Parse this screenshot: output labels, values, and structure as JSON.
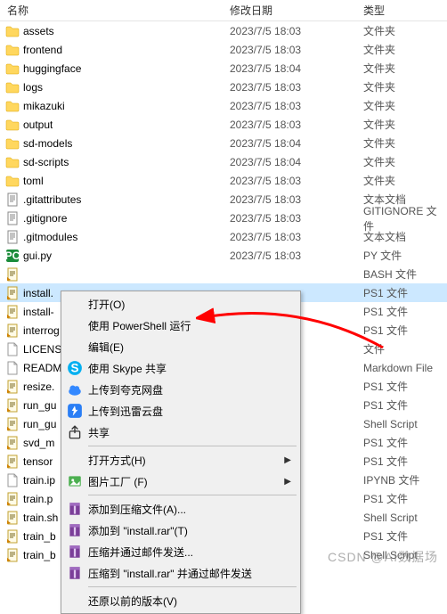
{
  "header": {
    "name": "名称",
    "date": "修改日期",
    "type": "类型"
  },
  "rows": [
    {
      "icon": "folder",
      "name": "assets",
      "date": "2023/7/5 18:03",
      "type": "文件夹"
    },
    {
      "icon": "folder",
      "name": "frontend",
      "date": "2023/7/5 18:03",
      "type": "文件夹"
    },
    {
      "icon": "folder",
      "name": "huggingface",
      "date": "2023/7/5 18:04",
      "type": "文件夹"
    },
    {
      "icon": "folder",
      "name": "logs",
      "date": "2023/7/5 18:03",
      "type": "文件夹"
    },
    {
      "icon": "folder",
      "name": "mikazuki",
      "date": "2023/7/5 18:03",
      "type": "文件夹"
    },
    {
      "icon": "folder",
      "name": "output",
      "date": "2023/7/5 18:03",
      "type": "文件夹"
    },
    {
      "icon": "folder",
      "name": "sd-models",
      "date": "2023/7/5 18:04",
      "type": "文件夹"
    },
    {
      "icon": "folder",
      "name": "sd-scripts",
      "date": "2023/7/5 18:04",
      "type": "文件夹"
    },
    {
      "icon": "folder",
      "name": "toml",
      "date": "2023/7/5 18:03",
      "type": "文件夹"
    },
    {
      "icon": "txt",
      "name": ".gitattributes",
      "date": "2023/7/5 18:03",
      "type": "文本文档"
    },
    {
      "icon": "txt",
      "name": ".gitignore",
      "date": "2023/7/5 18:03",
      "type": "GITIGNORE 文件"
    },
    {
      "icon": "txt",
      "name": ".gitmodules",
      "date": "2023/7/5 18:03",
      "type": "文本文档"
    },
    {
      "icon": "pc",
      "name": "gui.py",
      "date": "2023/7/5 18:03",
      "type": "PY 文件"
    },
    {
      "icon": "script",
      "name": "",
      "date": "",
      "type": "BASH 文件"
    },
    {
      "icon": "script",
      "name": "install.",
      "date": "",
      "type": "PS1 文件",
      "selected": true
    },
    {
      "icon": "script",
      "name": "install-",
      "date": "",
      "type": "PS1 文件"
    },
    {
      "icon": "script",
      "name": "interrog",
      "date": "",
      "type": "PS1 文件"
    },
    {
      "icon": "blank",
      "name": "LICENS",
      "date": "",
      "type": "文件"
    },
    {
      "icon": "blank",
      "name": "READM",
      "date": "",
      "type": "Markdown File"
    },
    {
      "icon": "script",
      "name": "resize.",
      "date": "",
      "type": "PS1 文件"
    },
    {
      "icon": "script",
      "name": "run_gu",
      "date": "",
      "type": "PS1 文件"
    },
    {
      "icon": "script",
      "name": "run_gu",
      "date": "",
      "type": "Shell Script"
    },
    {
      "icon": "script",
      "name": "svd_m",
      "date": "",
      "type": "PS1 文件"
    },
    {
      "icon": "script",
      "name": "tensor",
      "date": "",
      "type": "PS1 文件"
    },
    {
      "icon": "blank",
      "name": "train.ip",
      "date": "",
      "type": "IPYNB 文件"
    },
    {
      "icon": "script",
      "name": "train.p",
      "date": "",
      "type": "PS1 文件"
    },
    {
      "icon": "script",
      "name": "train.sh",
      "date": "",
      "type": "Shell Script"
    },
    {
      "icon": "script",
      "name": "train_b",
      "date": "",
      "type": "PS1 文件"
    },
    {
      "icon": "script",
      "name": "train_b",
      "date": "",
      "type": "Shell Script"
    }
  ],
  "menu": {
    "open": "打开(O)",
    "powershell": "使用 PowerShell 运行",
    "edit": "编辑(E)",
    "skype": "使用 Skype 共享",
    "kuake": "上传到夸克网盘",
    "xunlei": "上传到迅雷云盘",
    "share": "共享",
    "openwith": "打开方式(H)",
    "picfactory": "图片工厂 (F)",
    "addto_archive": "添加到压缩文件(A)...",
    "addto_rar": "添加到 \"install.rar\"(T)",
    "compress_email": "压缩并通过邮件发送...",
    "compress_rar_email": "压缩到 \"install.rar\" 并通过邮件发送",
    "restore": "还原以前的版本(V)"
  },
  "watermark": "CSDN @AI数据场"
}
